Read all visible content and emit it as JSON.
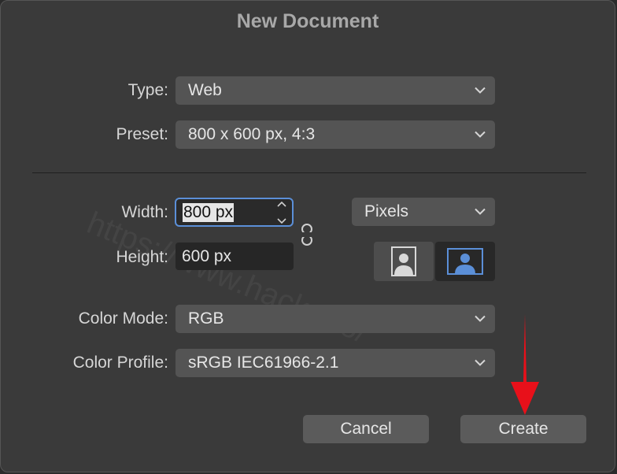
{
  "dialog": {
    "title": "New Document",
    "watermark": "https://www.hack.pro/"
  },
  "type": {
    "label": "Type:",
    "value": "Web"
  },
  "preset": {
    "label": "Preset:",
    "value": "800 x 600 px, 4:3"
  },
  "width": {
    "label": "Width:",
    "value": "800 px"
  },
  "height": {
    "label": "Height:",
    "value": "600 px"
  },
  "units": {
    "value": "Pixels"
  },
  "color_mode": {
    "label": "Color Mode:",
    "value": "RGB"
  },
  "color_profile": {
    "label": "Color Profile:",
    "value": "sRGB IEC61966-2.1"
  },
  "buttons": {
    "cancel": "Cancel",
    "create": "Create"
  },
  "colors": {
    "accent": "#5b8fd8",
    "arrow": "#e8101a"
  }
}
